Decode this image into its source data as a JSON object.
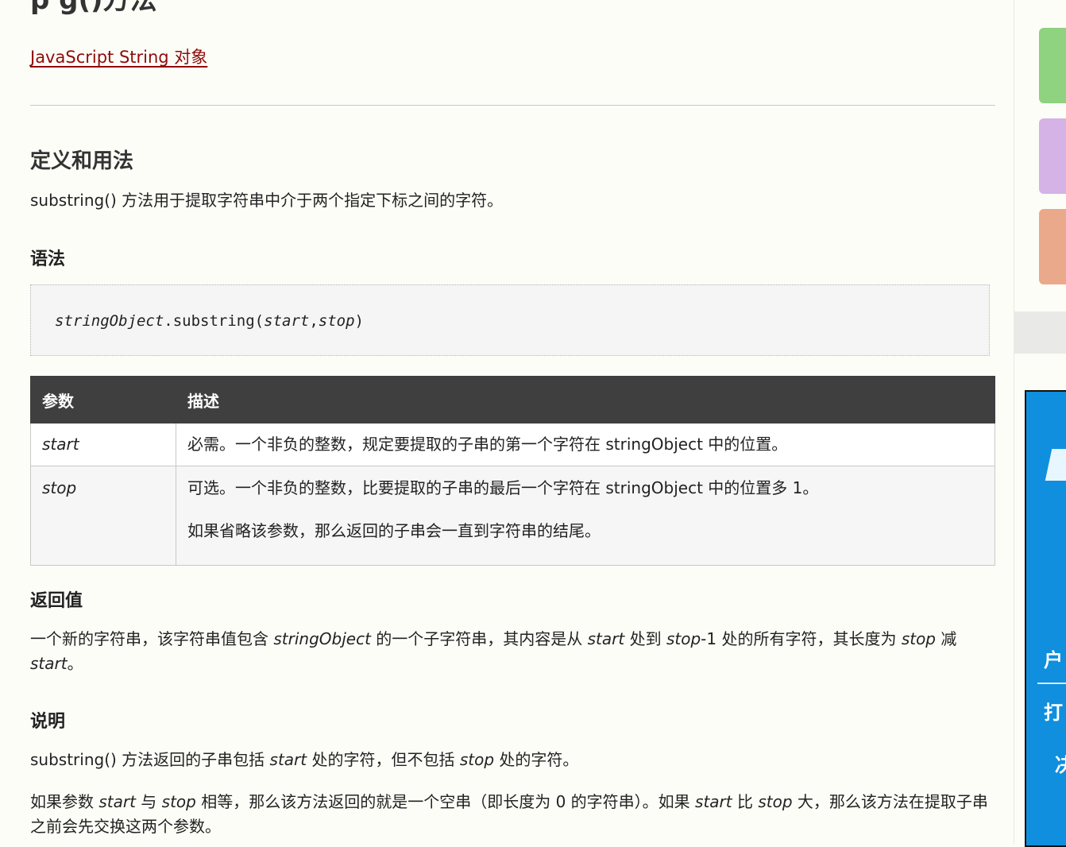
{
  "page": {
    "title_fragment": "p           g()方法",
    "back_link": "JavaScript String 对象"
  },
  "definition": {
    "heading": "定义和用法",
    "text": "substring() 方法用于提取字符串中介于两个指定下标之间的字符。"
  },
  "syntax": {
    "heading": "语法",
    "code_object": "stringObject",
    "code_method": ".substring(",
    "code_arg1": "start",
    "code_comma": ",",
    "code_arg2": "stop",
    "code_close": ")"
  },
  "params_table": {
    "headers": [
      "参数",
      "描述"
    ],
    "rows": [
      {
        "name": "start",
        "desc": [
          "必需。一个非负的整数，规定要提取的子串的第一个字符在 stringObject 中的位置。"
        ]
      },
      {
        "name": "stop",
        "desc": [
          "可选。一个非负的整数，比要提取的子串的最后一个字符在 stringObject 中的位置多 1。",
          "如果省略该参数，那么返回的子串会一直到字符串的结尾。"
        ]
      }
    ]
  },
  "return_value": {
    "heading": "返回值",
    "p1": "一个新的字符串，该字符串值包含 ",
    "p1_em1": "stringObject",
    "p1_b": " 的一个子字符串，其内容是从 ",
    "p1_em2": "start",
    "p1_c": " 处到 ",
    "p1_em3": "stop",
    "p1_d": "-1 处的所有字符，其长度为 ",
    "p1_em4": "stop",
    "p1_e": " 减 ",
    "p1_em5": "start",
    "p1_f": "。"
  },
  "notes": {
    "heading": "说明",
    "n1_a": "substring() 方法返回的子串包括 ",
    "n1_em1": "start",
    "n1_b": " 处的字符，但不包括 ",
    "n1_em2": "stop",
    "n1_c": " 处的字符。",
    "n2_a": "如果参数 ",
    "n2_em1": "start",
    "n2_b": " 与 ",
    "n2_em2": "stop",
    "n2_c": " 相等，那么该方法返回的就是一个空串（即长度为 0 的字符串）。如果 ",
    "n2_em3": "start",
    "n2_d": " 比 ",
    "n2_em4": "stop",
    "n2_e": " 大，那么该方法在提取子串之前会先交换这两个参数。"
  },
  "sidebar": {
    "tile_colors": [
      "#8fd27f",
      "#d6b3e6",
      "#eaa98a"
    ],
    "ad_color": "#0f8fde",
    "ad_text": [
      "户",
      "打",
      "决"
    ]
  }
}
